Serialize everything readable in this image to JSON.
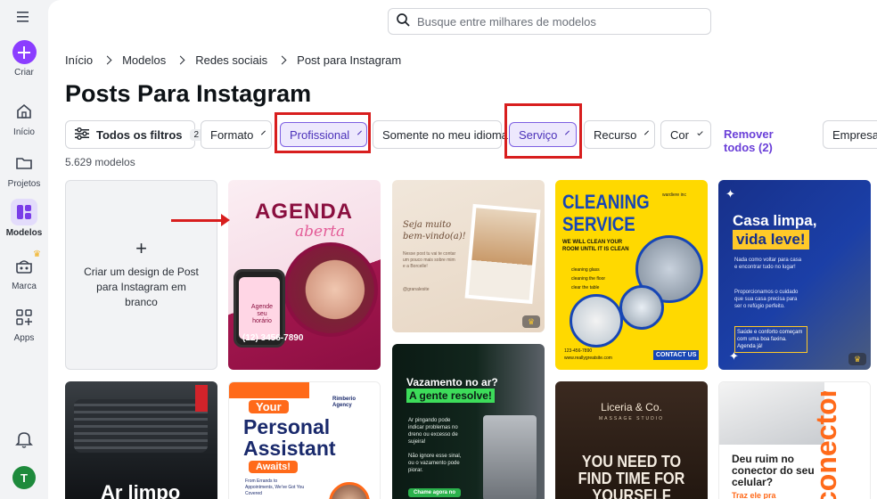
{
  "rail": {
    "create_label": "Criar",
    "items": [
      {
        "label": "Início",
        "icon": "home-icon"
      },
      {
        "label": "Projetos",
        "icon": "folder-icon"
      },
      {
        "label": "Modelos",
        "icon": "templates-icon"
      },
      {
        "label": "Marca",
        "icon": "brand-icon"
      },
      {
        "label": "Apps",
        "icon": "apps-icon"
      }
    ],
    "avatar_letter": "T"
  },
  "search": {
    "placeholder": "Busque entre milhares de modelos"
  },
  "breadcrumb": [
    "Início",
    "Modelos",
    "Redes sociais",
    "Post para Instagram"
  ],
  "page_title": "Posts Para Instagram",
  "filters": {
    "all_filters_label": "Todos os filtros",
    "all_filters_count": "2",
    "chips": [
      "Formato",
      "Profissional",
      "Somente no meu idioma",
      "Serviço",
      "Recurso",
      "Cor"
    ],
    "remove_all": "Remover todos (2)",
    "overflow_chip": "Empresar"
  },
  "results_count": "5.629 modelos",
  "blank_card": {
    "plus": "+",
    "text": "Criar um design de Post para Instagram em branco"
  },
  "templates": {
    "agenda": {
      "title": "AGENDA",
      "script": "aberta",
      "bubble": "Agende seu horário",
      "phone": "(12) 3456-7890"
    },
    "welcome": {
      "script": "Seja muito bem-vindo(a)!",
      "body": "Nesse post tu vai te contar um pouco mais sobre mim e a Borcelle!",
      "handle": "@granalesite"
    },
    "cleaning": {
      "line1": "CLEANING",
      "line2": "SERVICE",
      "brand": "wardiere inc",
      "tag": "WE WILL CLEAN YOUR ROOM UNTIL IT IS CLEAN",
      "items": [
        "cleaning glass",
        "cleaning the floor",
        "clear the table"
      ],
      "phone": "123-456-7890",
      "site": "www.reallygreatsite.com",
      "cta": "CONTACT US"
    },
    "casa": {
      "line1": "Casa limpa,",
      "line2": "vida leve!",
      "p1": "Nada como voltar para casa e encontrar tudo no lugar!",
      "p2": "Proporcionamos o cuidado que sua casa precisa para ser o refúgio perfeito.",
      "p3": "Saúde e conforto começam com uma boa faxina. Agenda já!"
    },
    "car": {
      "text": "Ar limpo"
    },
    "assistant": {
      "your": "Your",
      "line1": "Personal",
      "line2": "Assistant",
      "awaits": "Awaits!",
      "brand": "Rimberio Agency",
      "body": "From Errands to Appointments, We've Got You Covered"
    },
    "vazamento": {
      "line1": "Vazamento no ar?",
      "line2": "A gente resolve!",
      "p1": "Ar pingando pode indicar problemas no dreno ou excesso de sujeira!",
      "p2": "Não ignore esse sinal, ou o vazamento pode piorar.",
      "cta": "Chame agora no"
    },
    "liceria": {
      "brand": "Liceria & Co.",
      "sub": "MASSAGE STUDIO",
      "line1": "YOU NEED TO",
      "line2": "FIND TIME FOR",
      "line3": "YOURSELF"
    },
    "celular": {
      "big": "conector",
      "q": "Deu ruim no conector do seu celular?",
      "cta": "Traz ele pra"
    }
  },
  "colors": {
    "accent": "#8b3dff",
    "highlight_red": "#d81e1e",
    "chip_selected": "#ede8fd"
  }
}
